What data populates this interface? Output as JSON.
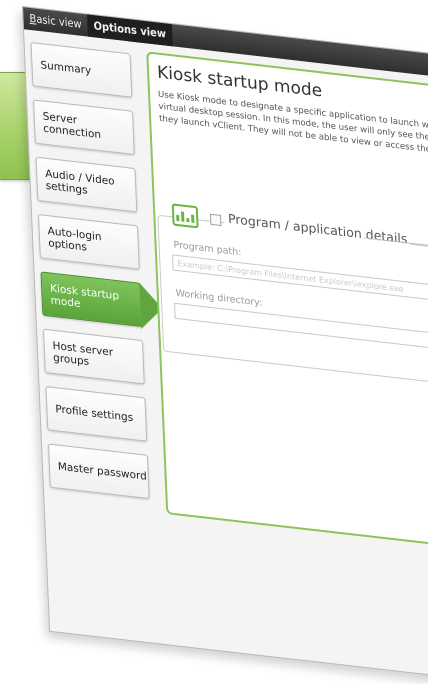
{
  "top_tabs": {
    "basic_view_first": "B",
    "basic_view_rest": "asic view",
    "options_view": "Options view"
  },
  "sidebar": {
    "items": [
      {
        "label": "Summary"
      },
      {
        "label": "Server connection"
      },
      {
        "label": "Audio / Video settings"
      },
      {
        "label": "Auto-login options"
      },
      {
        "label": "Kiosk startup mode"
      },
      {
        "label": "Host server groups"
      },
      {
        "label": "Profile settings"
      },
      {
        "label": "Master password"
      }
    ],
    "active_index": 4
  },
  "panel": {
    "title": "Kiosk startup mode",
    "description_lines": [
      "Use Kiosk mode to designate a specific application to launch when",
      "virtual desktop session. In this mode, the user will only see the de",
      "they launch vClient. They will not be able to view or access the en"
    ],
    "group": {
      "icon": "bar-chart-icon",
      "legend": "Program / application details",
      "program_path_label": "Program path:",
      "program_path_placeholder": "Example: C:\\Program Files\\Internet Explorer\\iexplore.exe",
      "working_directory_label": "Working directory:",
      "working_directory_value": ""
    }
  },
  "colors": {
    "accent_green": "#5fa63e",
    "panel_border": "#8cc45c",
    "top_bar": "#2f2f2f"
  }
}
